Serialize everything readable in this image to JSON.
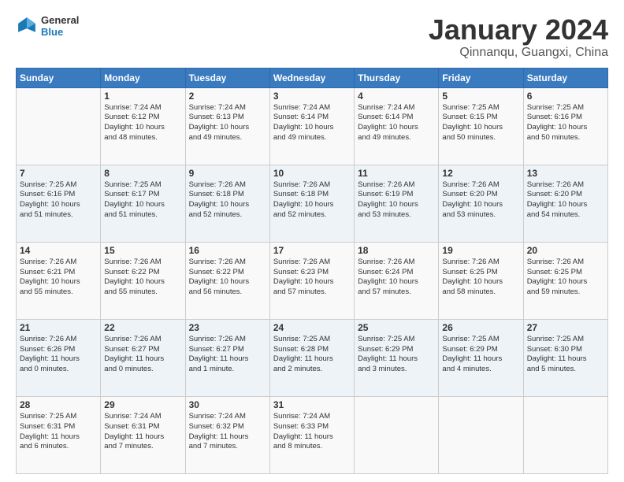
{
  "logo": {
    "text_general": "General",
    "text_blue": "Blue"
  },
  "header": {
    "month": "January 2024",
    "location": "Qinnanqu, Guangxi, China"
  },
  "days_header": [
    "Sunday",
    "Monday",
    "Tuesday",
    "Wednesday",
    "Thursday",
    "Friday",
    "Saturday"
  ],
  "weeks": [
    [
      {
        "day": "",
        "info": ""
      },
      {
        "day": "1",
        "info": "Sunrise: 7:24 AM\nSunset: 6:12 PM\nDaylight: 10 hours\nand 48 minutes."
      },
      {
        "day": "2",
        "info": "Sunrise: 7:24 AM\nSunset: 6:13 PM\nDaylight: 10 hours\nand 49 minutes."
      },
      {
        "day": "3",
        "info": "Sunrise: 7:24 AM\nSunset: 6:14 PM\nDaylight: 10 hours\nand 49 minutes."
      },
      {
        "day": "4",
        "info": "Sunrise: 7:24 AM\nSunset: 6:14 PM\nDaylight: 10 hours\nand 49 minutes."
      },
      {
        "day": "5",
        "info": "Sunrise: 7:25 AM\nSunset: 6:15 PM\nDaylight: 10 hours\nand 50 minutes."
      },
      {
        "day": "6",
        "info": "Sunrise: 7:25 AM\nSunset: 6:16 PM\nDaylight: 10 hours\nand 50 minutes."
      }
    ],
    [
      {
        "day": "7",
        "info": "Sunrise: 7:25 AM\nSunset: 6:16 PM\nDaylight: 10 hours\nand 51 minutes."
      },
      {
        "day": "8",
        "info": "Sunrise: 7:25 AM\nSunset: 6:17 PM\nDaylight: 10 hours\nand 51 minutes."
      },
      {
        "day": "9",
        "info": "Sunrise: 7:26 AM\nSunset: 6:18 PM\nDaylight: 10 hours\nand 52 minutes."
      },
      {
        "day": "10",
        "info": "Sunrise: 7:26 AM\nSunset: 6:18 PM\nDaylight: 10 hours\nand 52 minutes."
      },
      {
        "day": "11",
        "info": "Sunrise: 7:26 AM\nSunset: 6:19 PM\nDaylight: 10 hours\nand 53 minutes."
      },
      {
        "day": "12",
        "info": "Sunrise: 7:26 AM\nSunset: 6:20 PM\nDaylight: 10 hours\nand 53 minutes."
      },
      {
        "day": "13",
        "info": "Sunrise: 7:26 AM\nSunset: 6:20 PM\nDaylight: 10 hours\nand 54 minutes."
      }
    ],
    [
      {
        "day": "14",
        "info": "Sunrise: 7:26 AM\nSunset: 6:21 PM\nDaylight: 10 hours\nand 55 minutes."
      },
      {
        "day": "15",
        "info": "Sunrise: 7:26 AM\nSunset: 6:22 PM\nDaylight: 10 hours\nand 55 minutes."
      },
      {
        "day": "16",
        "info": "Sunrise: 7:26 AM\nSunset: 6:22 PM\nDaylight: 10 hours\nand 56 minutes."
      },
      {
        "day": "17",
        "info": "Sunrise: 7:26 AM\nSunset: 6:23 PM\nDaylight: 10 hours\nand 57 minutes."
      },
      {
        "day": "18",
        "info": "Sunrise: 7:26 AM\nSunset: 6:24 PM\nDaylight: 10 hours\nand 57 minutes."
      },
      {
        "day": "19",
        "info": "Sunrise: 7:26 AM\nSunset: 6:25 PM\nDaylight: 10 hours\nand 58 minutes."
      },
      {
        "day": "20",
        "info": "Sunrise: 7:26 AM\nSunset: 6:25 PM\nDaylight: 10 hours\nand 59 minutes."
      }
    ],
    [
      {
        "day": "21",
        "info": "Sunrise: 7:26 AM\nSunset: 6:26 PM\nDaylight: 11 hours\nand 0 minutes."
      },
      {
        "day": "22",
        "info": "Sunrise: 7:26 AM\nSunset: 6:27 PM\nDaylight: 11 hours\nand 0 minutes."
      },
      {
        "day": "23",
        "info": "Sunrise: 7:26 AM\nSunset: 6:27 PM\nDaylight: 11 hours\nand 1 minute."
      },
      {
        "day": "24",
        "info": "Sunrise: 7:25 AM\nSunset: 6:28 PM\nDaylight: 11 hours\nand 2 minutes."
      },
      {
        "day": "25",
        "info": "Sunrise: 7:25 AM\nSunset: 6:29 PM\nDaylight: 11 hours\nand 3 minutes."
      },
      {
        "day": "26",
        "info": "Sunrise: 7:25 AM\nSunset: 6:29 PM\nDaylight: 11 hours\nand 4 minutes."
      },
      {
        "day": "27",
        "info": "Sunrise: 7:25 AM\nSunset: 6:30 PM\nDaylight: 11 hours\nand 5 minutes."
      }
    ],
    [
      {
        "day": "28",
        "info": "Sunrise: 7:25 AM\nSunset: 6:31 PM\nDaylight: 11 hours\nand 6 minutes."
      },
      {
        "day": "29",
        "info": "Sunrise: 7:24 AM\nSunset: 6:31 PM\nDaylight: 11 hours\nand 7 minutes."
      },
      {
        "day": "30",
        "info": "Sunrise: 7:24 AM\nSunset: 6:32 PM\nDaylight: 11 hours\nand 7 minutes."
      },
      {
        "day": "31",
        "info": "Sunrise: 7:24 AM\nSunset: 6:33 PM\nDaylight: 11 hours\nand 8 minutes."
      },
      {
        "day": "",
        "info": ""
      },
      {
        "day": "",
        "info": ""
      },
      {
        "day": "",
        "info": ""
      }
    ]
  ]
}
